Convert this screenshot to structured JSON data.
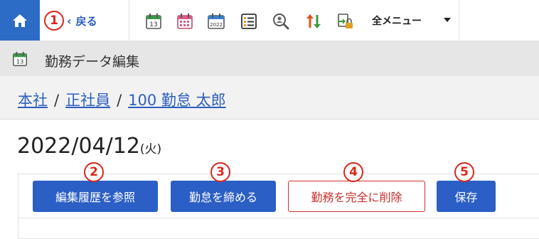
{
  "toolbar": {
    "back_label": "戻る",
    "menu_label": "全メニュー",
    "icons": [
      "home-icon",
      "calendar-13-icon",
      "calendar-grid-icon",
      "calendar-2022-icon",
      "list-icon",
      "search-person-icon",
      "sort-arrows-icon",
      "lock-transfer-icon"
    ],
    "calendar_day": "13",
    "calendar_year": "2022"
  },
  "titlebar": {
    "title": "勤務データ編集"
  },
  "breadcrumb": {
    "items": [
      "本社",
      "正社員",
      "100 勤怠 太郎"
    ],
    "separator": "/"
  },
  "date": {
    "value": "2022/04/12",
    "weekday": "(火)"
  },
  "actions": {
    "history": "編集履歴を参照",
    "close": "勤怠を締める",
    "delete": "勤務を完全に削除",
    "save": "保存"
  },
  "markers": [
    "1",
    "2",
    "3",
    "4",
    "5"
  ],
  "colors": {
    "primary": "#2b5fc5",
    "danger": "#c9302c",
    "marker": "#d9261c"
  }
}
